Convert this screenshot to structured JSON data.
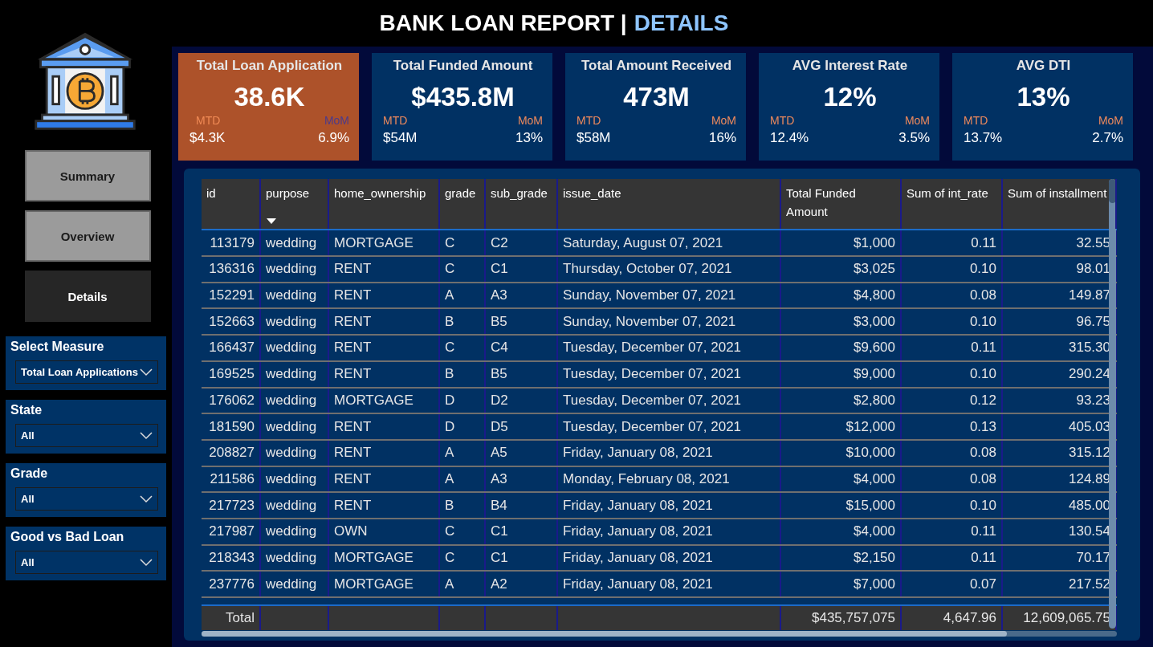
{
  "header": {
    "title": "BANK LOAN REPORT |",
    "title_highlight": "DETAILS"
  },
  "nav": [
    {
      "label": "Summary",
      "selected": false
    },
    {
      "label": "Overview",
      "selected": false
    },
    {
      "label": "Details",
      "selected": true
    }
  ],
  "filters": [
    {
      "label": "Select Measure",
      "value": "Total Loan Applications"
    },
    {
      "label": "State",
      "value": "All"
    },
    {
      "label": "Grade",
      "value": "All"
    },
    {
      "label": "Good vs Bad Loan",
      "value": "All"
    }
  ],
  "kpis": [
    {
      "title": "Total Loan Application",
      "value": "38.6K",
      "mtd_label": "MTD",
      "mtd_value": "$4.3K",
      "mom_label": "MoM",
      "mom_value": "6.9%",
      "selected": true
    },
    {
      "title": "Total Funded Amount",
      "value": "$435.8M",
      "mtd_label": "MTD",
      "mtd_value": "$54M",
      "mom_label": "MoM",
      "mom_value": "13%",
      "selected": false
    },
    {
      "title": "Total Amount Received",
      "value": "473M",
      "mtd_label": "MTD",
      "mtd_value": "$58M",
      "mom_label": "MoM",
      "mom_value": "16%",
      "selected": false
    },
    {
      "title": "AVG Interest Rate",
      "value": "12%",
      "mtd_label": "MTD",
      "mtd_value": "12.4%",
      "mom_label": "MoM",
      "mom_value": "3.5%",
      "selected": false
    },
    {
      "title": "AVG DTI",
      "value": "13%",
      "mtd_label": "MTD",
      "mtd_value": "13.7%",
      "mom_label": "MoM",
      "mom_value": "2.7%",
      "selected": false
    }
  ],
  "table": {
    "columns": [
      {
        "label": "id",
        "kind": "number",
        "sorted": false
      },
      {
        "label": "purpose",
        "kind": "text",
        "sorted": true
      },
      {
        "label": "home_ownership",
        "kind": "text",
        "sorted": false
      },
      {
        "label": "grade",
        "kind": "text",
        "sorted": false
      },
      {
        "label": "sub_grade",
        "kind": "text",
        "sorted": false
      },
      {
        "label": "issue_date",
        "kind": "text",
        "sorted": false
      },
      {
        "label": "Total Funded Amount",
        "kind": "number",
        "sorted": false
      },
      {
        "label": "Sum of int_rate",
        "kind": "number",
        "sorted": false
      },
      {
        "label": "Sum of installment",
        "kind": "number",
        "sorted": false
      }
    ],
    "rows": [
      [
        "113179",
        "wedding",
        "MORTGAGE",
        "C",
        "C2",
        "Saturday, August 07, 2021",
        "$1,000",
        "0.11",
        "32.55"
      ],
      [
        "136316",
        "wedding",
        "RENT",
        "C",
        "C1",
        "Thursday, October 07, 2021",
        "$3,025",
        "0.10",
        "98.01"
      ],
      [
        "152291",
        "wedding",
        "RENT",
        "A",
        "A3",
        "Sunday, November 07, 2021",
        "$4,800",
        "0.08",
        "149.87"
      ],
      [
        "152663",
        "wedding",
        "RENT",
        "B",
        "B5",
        "Sunday, November 07, 2021",
        "$3,000",
        "0.10",
        "96.75"
      ],
      [
        "166437",
        "wedding",
        "RENT",
        "C",
        "C4",
        "Tuesday, December 07, 2021",
        "$9,600",
        "0.11",
        "315.30"
      ],
      [
        "169525",
        "wedding",
        "RENT",
        "B",
        "B5",
        "Tuesday, December 07, 2021",
        "$9,000",
        "0.10",
        "290.24"
      ],
      [
        "176062",
        "wedding",
        "MORTGAGE",
        "D",
        "D2",
        "Tuesday, December 07, 2021",
        "$2,800",
        "0.12",
        "93.23"
      ],
      [
        "181590",
        "wedding",
        "RENT",
        "D",
        "D5",
        "Tuesday, December 07, 2021",
        "$12,000",
        "0.13",
        "405.03"
      ],
      [
        "208827",
        "wedding",
        "RENT",
        "A",
        "A5",
        "Friday, January 08, 2021",
        "$10,000",
        "0.08",
        "315.12"
      ],
      [
        "211586",
        "wedding",
        "RENT",
        "A",
        "A3",
        "Monday, February 08, 2021",
        "$4,000",
        "0.08",
        "124.89"
      ],
      [
        "217723",
        "wedding",
        "RENT",
        "B",
        "B4",
        "Friday, January 08, 2021",
        "$15,000",
        "0.10",
        "485.00"
      ],
      [
        "217987",
        "wedding",
        "OWN",
        "C",
        "C1",
        "Friday, January 08, 2021",
        "$4,000",
        "0.11",
        "130.54"
      ],
      [
        "218343",
        "wedding",
        "MORTGAGE",
        "C",
        "C1",
        "Friday, January 08, 2021",
        "$2,150",
        "0.11",
        "70.17"
      ],
      [
        "237776",
        "wedding",
        "MORTGAGE",
        "A",
        "A2",
        "Friday, January 08, 2021",
        "$7,000",
        "0.07",
        "217.52"
      ]
    ],
    "totals": {
      "label": "Total",
      "cells": [
        null,
        null,
        null,
        null,
        null,
        "$435,757,075",
        "4,647.96",
        "12,609,065.75"
      ]
    }
  }
}
